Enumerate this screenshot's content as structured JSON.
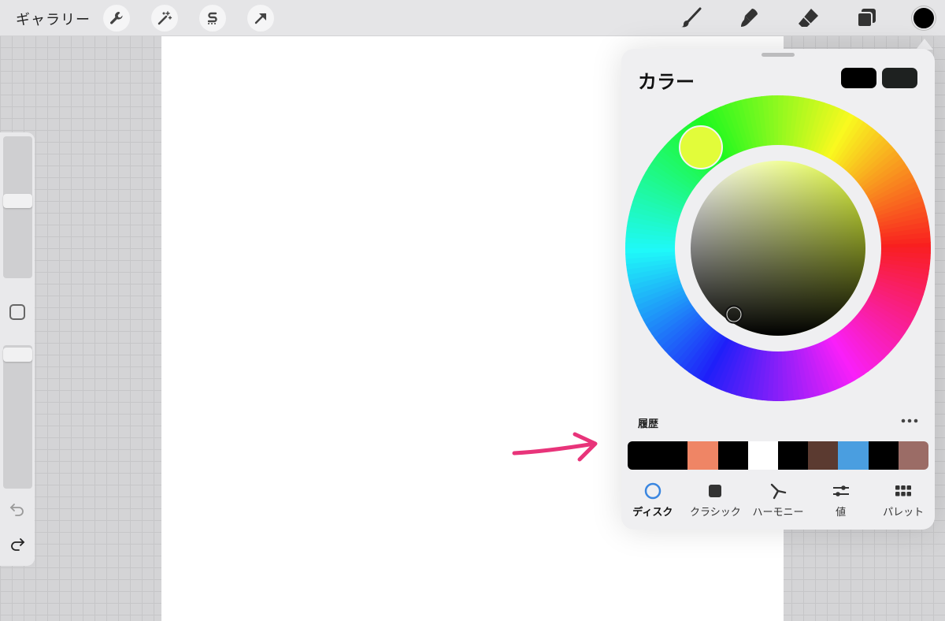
{
  "topbar": {
    "gallery_label": "ギャラリー",
    "tools_left": [
      "wrench-icon",
      "magic-wand-icon",
      "selection-s-icon",
      "transform-arrow-icon"
    ],
    "tools_right": [
      "brush-icon",
      "smudge-icon",
      "eraser-icon",
      "layers-icon"
    ],
    "current_color": "#000000"
  },
  "sidebar": {
    "size_slider_level": 0.55,
    "opacity_slider_level": 1.0
  },
  "color_panel": {
    "title": "カラー",
    "primary_swatch": "#000000",
    "secondary_swatch": "#1e2120",
    "hue_selector_color": "#e2fc3a",
    "history_label": "履歴",
    "more_label": "more-dots-icon",
    "history_colors": [
      "#000000",
      "#000000",
      "#ef8565",
      "#000000",
      "#ffffff",
      "#000000",
      "#5b3a30",
      "#4a9ee0",
      "#000000",
      "#9b6c66"
    ],
    "tabs": [
      {
        "label": "ディスク",
        "icon": "disc-icon",
        "active": true
      },
      {
        "label": "クラシック",
        "icon": "classic-square-icon",
        "active": false
      },
      {
        "label": "ハーモニー",
        "icon": "harmony-icon",
        "active": false
      },
      {
        "label": "値",
        "icon": "value-sliders-icon",
        "active": false
      },
      {
        "label": "パレット",
        "icon": "palette-grid-icon",
        "active": false
      }
    ]
  },
  "annotation": {
    "arrow_color": "#e8347a"
  }
}
